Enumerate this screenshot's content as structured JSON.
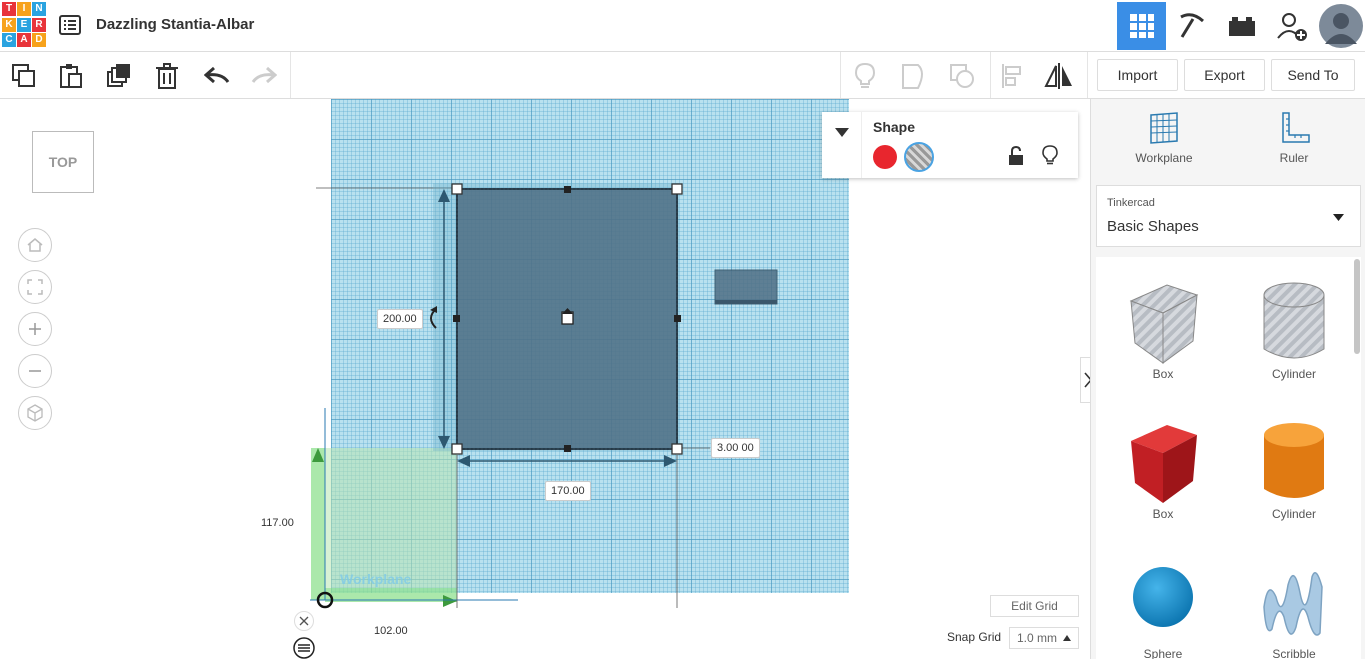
{
  "header": {
    "logo_letters": [
      "T",
      "I",
      "N",
      "K",
      "E",
      "R",
      "C",
      "A",
      "D"
    ],
    "logo_colors": [
      "#e8343a",
      "#f7a21b",
      "#2aa3e0",
      "#f7a21b",
      "#2aa3e0",
      "#e8343a",
      "#2aa3e0",
      "#e8343a",
      "#f7a21b"
    ],
    "doc_title": "Dazzling Stantia-Albar"
  },
  "toolbar": {
    "import_label": "Import",
    "export_label": "Export",
    "sendto_label": "Send To"
  },
  "viewcube": {
    "label": "TOP"
  },
  "inspector": {
    "title": "Shape",
    "solid_color": "#e8262e"
  },
  "dimensions": {
    "height": "200.00",
    "width": "170.00",
    "elevation": "3.00 00",
    "pos_y": "117.00",
    "pos_x": "102.00"
  },
  "workplane": {
    "label": "Workplane"
  },
  "right_panel": {
    "workplane_label": "Workplane",
    "ruler_label": "Ruler",
    "library_category": "Tinkercad",
    "library_name": "Basic Shapes",
    "shapes": [
      {
        "label": "Box"
      },
      {
        "label": "Cylinder"
      },
      {
        "label": "Box"
      },
      {
        "label": "Cylinder"
      },
      {
        "label": "Sphere"
      },
      {
        "label": "Scribble"
      }
    ]
  },
  "bottom": {
    "edit_grid_label": "Edit Grid",
    "snap_grid_label": "Snap Grid",
    "snap_value": "1.0 mm"
  },
  "colors": {
    "accent": "#3a8ee6",
    "grid": "#b9e1ef",
    "shape": "#4f6f85"
  }
}
